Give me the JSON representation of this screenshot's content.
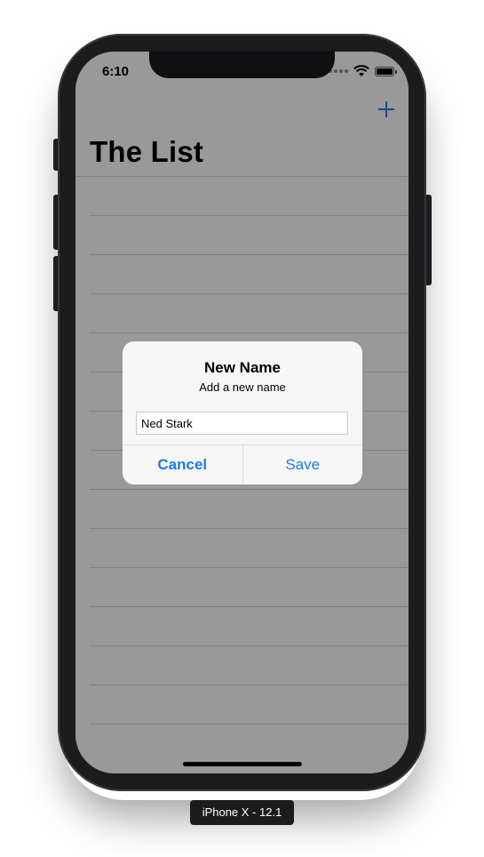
{
  "status_bar": {
    "time": "6:10",
    "icons": [
      "signal-dots-icon",
      "wifi-icon",
      "battery-icon"
    ]
  },
  "nav": {
    "title": "The List",
    "add_icon": "plus-icon"
  },
  "alert": {
    "title": "New Name",
    "message": "Add a new name",
    "field_value": "Ned Stark",
    "cancel_label": "Cancel",
    "save_label": "Save"
  },
  "simulator": {
    "device_label": "iPhone X - 12.1"
  },
  "colors": {
    "accent": "#1a7de6",
    "device_frame": "#1c1c1e",
    "dim_overlay": "rgba(0,0,0,0.40)"
  }
}
